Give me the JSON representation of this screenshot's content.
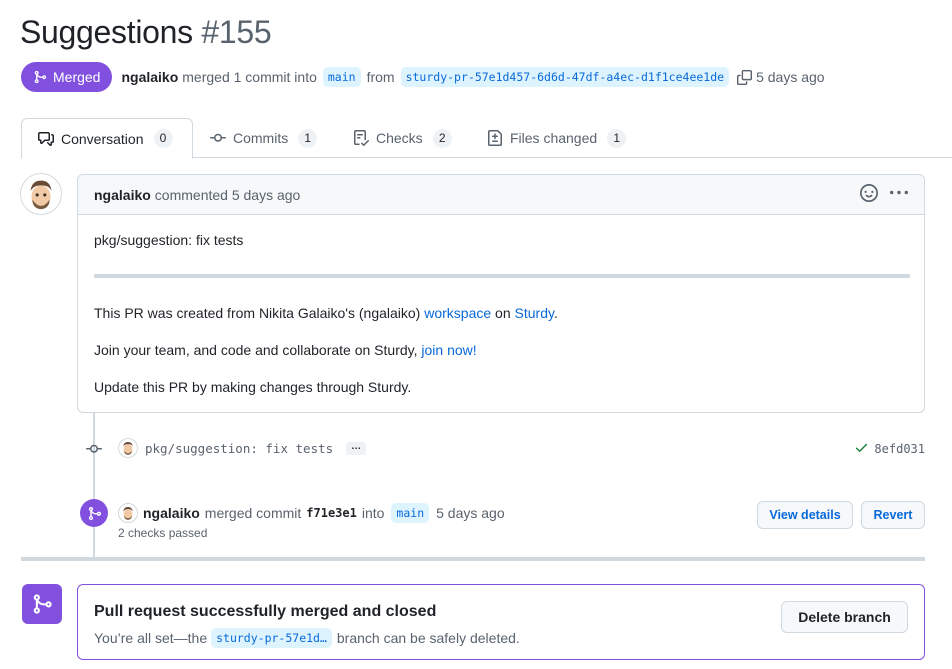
{
  "header": {
    "title": "Suggestions",
    "number": "#155"
  },
  "meta": {
    "state": "Merged",
    "author": "ngalaiko",
    "text_merged": "merged 1 commit into",
    "base_branch": "main",
    "text_from": "from",
    "head_branch": "sturdy-pr-57e1d457-6d6d-47df-a4ec-d1f1ce4ee1de",
    "time": "5 days ago"
  },
  "tabs": [
    {
      "label": "Conversation",
      "count": "0"
    },
    {
      "label": "Commits",
      "count": "1"
    },
    {
      "label": "Checks",
      "count": "2"
    },
    {
      "label": "Files changed",
      "count": "1"
    }
  ],
  "comment": {
    "author": "ngalaiko",
    "action": "commented 5 days ago",
    "line1": "pkg/suggestion: fix tests",
    "line2_prefix": "This PR was created from Nikita Galaiko's (ngalaiko)",
    "line2_link1": "workspace",
    "line2_mid": "on",
    "line2_link2": "Sturdy",
    "line2_suffix": ".",
    "line3_prefix": "Join your team, and code and collaborate on Sturdy,",
    "line3_link": "join now!",
    "line4": "Update this PR by making changes through Sturdy."
  },
  "commit": {
    "message": "pkg/suggestion: fix tests",
    "ellipsis": "…",
    "sha": "8efd031"
  },
  "merge_event": {
    "author": "ngalaiko",
    "text": "merged commit",
    "sha": "f71e3e1",
    "into": "into",
    "branch": "main",
    "time": "5 days ago",
    "checks": "2 checks passed",
    "view_details": "View details",
    "revert": "Revert"
  },
  "merged_box": {
    "title": "Pull request successfully merged and closed",
    "sub_prefix": "You’re all set—the",
    "branch": "sturdy-pr-57e1d…",
    "sub_suffix": "branch can be safely deleted.",
    "delete_button": "Delete branch"
  },
  "colors": {
    "merged": "#8250df",
    "link": "#0969da",
    "success": "#1a7f37"
  }
}
